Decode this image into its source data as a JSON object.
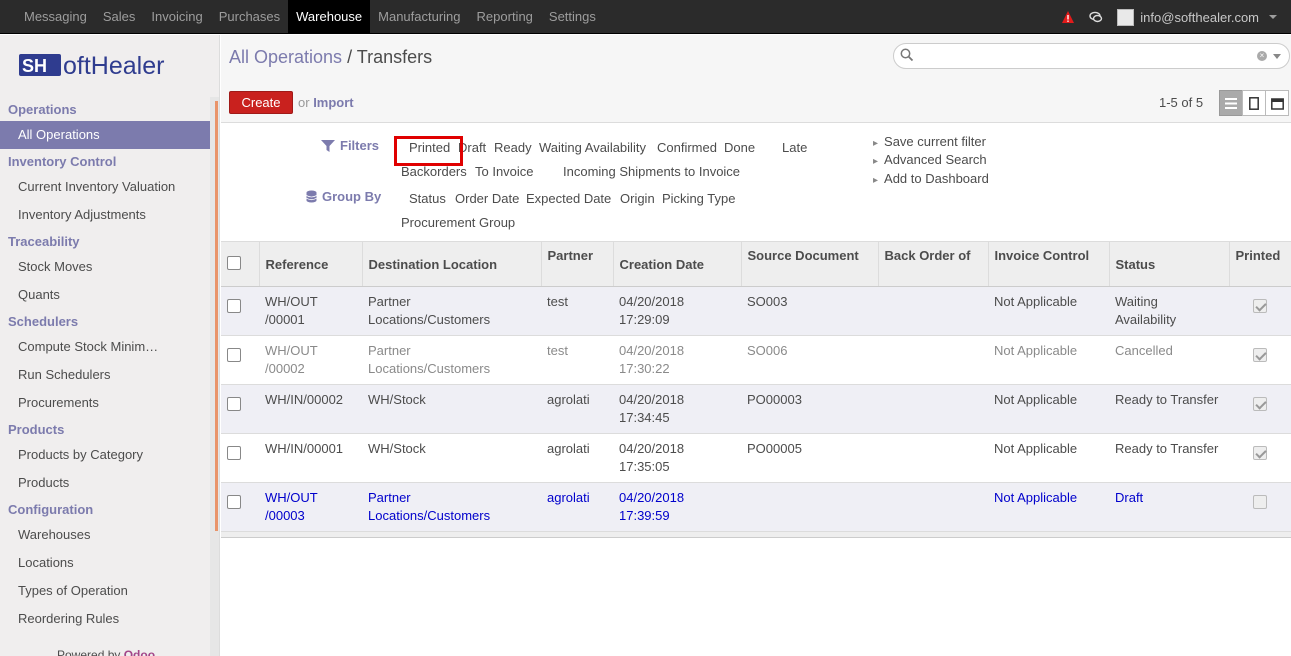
{
  "topbar": {
    "menu": [
      "Messaging",
      "Sales",
      "Invoicing",
      "Purchases",
      "Warehouse",
      "Manufacturing",
      "Reporting",
      "Settings"
    ],
    "active_index": 4,
    "user_email": "info@softhealer.com"
  },
  "brand": {
    "logo_text": "SoftHealer"
  },
  "sidebar": {
    "sections": [
      {
        "title": "Operations",
        "items": [
          "All Operations"
        ]
      },
      {
        "title": "Inventory Control",
        "items": [
          "Current Inventory Valuation",
          "Inventory Adjustments"
        ]
      },
      {
        "title": "Traceability",
        "items": [
          "Stock Moves",
          "Quants"
        ]
      },
      {
        "title": "Schedulers",
        "items": [
          "Compute Stock Minimum Rules Only",
          "Run Schedulers",
          "Procurements"
        ]
      },
      {
        "title": "Products",
        "items": [
          "Products by Category",
          "Products"
        ]
      },
      {
        "title": "Configuration",
        "items": [
          "Warehouses",
          "Locations",
          "Types of Operation",
          "Reordering Rules"
        ]
      }
    ],
    "active_item": "All Operations",
    "powered_by": "Powered by",
    "powered_brand": "Odoo"
  },
  "control": {
    "breadcrumb_parent": "All Operations",
    "breadcrumb_sep": " / ",
    "breadcrumb_current": "Transfers",
    "create_label": "Create",
    "or_text": "or",
    "import_label": "Import",
    "pager": "1-5 of 5"
  },
  "search_options": {
    "filters_label": "Filters",
    "group_by_label": "Group By",
    "filters": {
      "printed": "Printed",
      "draft": "Draft",
      "ready": "Ready",
      "waiting": "Waiting Availability",
      "confirmed": "Confirmed",
      "done": "Done",
      "late": "Late",
      "backorders": "Backorders",
      "to_invoice": "To Invoice",
      "incoming": "Incoming Shipments to Invoice"
    },
    "group_by": {
      "status": "Status",
      "order_date": "Order Date",
      "expected_date": "Expected Date",
      "origin": "Origin",
      "picking_type": "Picking Type",
      "procurement_group": "Procurement Group"
    },
    "side": {
      "save": "Save current filter",
      "advanced": "Advanced Search",
      "dashboard": "Add to Dashboard"
    }
  },
  "table": {
    "headers": {
      "reference": "Reference",
      "destination": "Destination Location",
      "partner": "Partner",
      "creation_date": "Creation Date",
      "source_document": "Source Document",
      "back_order_of": "Back Order of",
      "invoice_control": "Invoice Control",
      "status": "Status",
      "printed": "Printed"
    },
    "rows": [
      {
        "ref1": "WH/OUT",
        "ref2": "/00001",
        "dest1": "Partner",
        "dest2": "Locations/Customers",
        "partner": "test",
        "date1": "04/20/2018",
        "date2": "17:29:09",
        "source": "SO003",
        "backorder": "",
        "invoice": "Not Applicable",
        "status1": "Waiting",
        "status2": "Availability",
        "printed": true
      },
      {
        "ref1": "WH/OUT",
        "ref2": "/00002",
        "dest1": "Partner",
        "dest2": "Locations/Customers",
        "partner": "test",
        "date1": "04/20/2018",
        "date2": "17:30:22",
        "source": "SO006",
        "backorder": "",
        "invoice": "Not Applicable",
        "status1": "Cancelled",
        "status2": "",
        "printed": true
      },
      {
        "ref1": "WH/IN/00002",
        "ref2": "",
        "dest1": "WH/Stock",
        "dest2": "",
        "partner": "agrolati",
        "date1": "04/20/2018",
        "date2": "17:34:45",
        "source": "PO00003",
        "backorder": "",
        "invoice": "Not Applicable",
        "status1": "Ready to Transfer",
        "status2": "",
        "printed": true
      },
      {
        "ref1": "WH/IN/00001",
        "ref2": "",
        "dest1": "WH/Stock",
        "dest2": "",
        "partner": "agrolati",
        "date1": "04/20/2018",
        "date2": "17:35:05",
        "source": "PO00005",
        "backorder": "",
        "invoice": "Not Applicable",
        "status1": "Ready to Transfer",
        "status2": "",
        "printed": true
      },
      {
        "ref1": "WH/OUT",
        "ref2": "/00003",
        "dest1": "Partner",
        "dest2": "Locations/Customers",
        "partner": "agrolati",
        "date1": "04/20/2018",
        "date2": "17:39:59",
        "source": "",
        "backorder": "",
        "invoice": "Not Applicable",
        "status1": "Draft",
        "status2": "",
        "printed": false
      }
    ]
  },
  "colors": {
    "topbar": "#2b2b2b",
    "brand_purple": "#7c7bad",
    "create_red": "#c9211e",
    "highlight_red": "#e00000",
    "draft_blue": "#0000cc"
  }
}
